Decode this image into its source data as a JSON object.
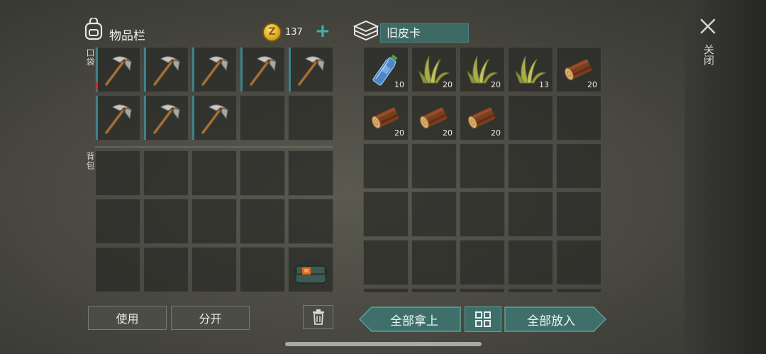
{
  "inventory": {
    "title": "物品栏",
    "coins": "137",
    "pocket_label": "口袋",
    "backpack_label": "背包",
    "pocket_slots": [
      {
        "item": "pickaxe-icon",
        "qty": "",
        "mark": "red"
      },
      {
        "item": "pickaxe-icon",
        "qty": "",
        "mark": "teal"
      },
      {
        "item": "pickaxe-icon",
        "qty": "",
        "mark": "teal"
      },
      {
        "item": "pickaxe-icon",
        "qty": "",
        "mark": "teal"
      },
      {
        "item": "pickaxe-icon",
        "qty": "",
        "mark": "teal"
      },
      {
        "item": "pickaxe-icon",
        "qty": "",
        "mark": "teal"
      },
      {
        "item": "pickaxe-icon",
        "qty": "",
        "mark": "teal"
      },
      {
        "item": "pickaxe-icon",
        "qty": "",
        "mark": "teal"
      },
      {
        "item": "",
        "qty": "",
        "mark": ""
      },
      {
        "item": "",
        "qty": "",
        "mark": ""
      }
    ],
    "backpack_slots": [
      {
        "item": ""
      },
      {
        "item": ""
      },
      {
        "item": ""
      },
      {
        "item": ""
      },
      {
        "item": ""
      },
      {
        "item": ""
      },
      {
        "item": ""
      },
      {
        "item": ""
      },
      {
        "item": ""
      },
      {
        "item": ""
      },
      {
        "item": ""
      },
      {
        "item": ""
      },
      {
        "item": ""
      },
      {
        "item": ""
      },
      {
        "item": "bag-icon"
      }
    ]
  },
  "container": {
    "name": "旧皮卡",
    "slots": [
      {
        "item": "water-bottle-icon",
        "qty": "10"
      },
      {
        "item": "plant-fiber-icon",
        "qty": "20"
      },
      {
        "item": "plant-fiber-icon",
        "qty": "20"
      },
      {
        "item": "plant-fiber-icon",
        "qty": "13"
      },
      {
        "item": "log-icon",
        "qty": "20"
      },
      {
        "item": "log-icon",
        "qty": "20"
      },
      {
        "item": "log-icon",
        "qty": "20"
      },
      {
        "item": "log-icon",
        "qty": "20"
      },
      {
        "item": "",
        "qty": ""
      },
      {
        "item": "",
        "qty": ""
      },
      {
        "item": "",
        "qty": ""
      },
      {
        "item": "",
        "qty": ""
      },
      {
        "item": "",
        "qty": ""
      },
      {
        "item": "",
        "qty": ""
      },
      {
        "item": "",
        "qty": ""
      },
      {
        "item": "",
        "qty": ""
      },
      {
        "item": "",
        "qty": ""
      },
      {
        "item": "",
        "qty": ""
      },
      {
        "item": "",
        "qty": ""
      },
      {
        "item": "",
        "qty": ""
      },
      {
        "item": "",
        "qty": ""
      },
      {
        "item": "",
        "qty": ""
      },
      {
        "item": "",
        "qty": ""
      },
      {
        "item": "",
        "qty": ""
      },
      {
        "item": "",
        "qty": ""
      },
      {
        "item": "",
        "qty": ""
      },
      {
        "item": "",
        "qty": ""
      },
      {
        "item": "",
        "qty": ""
      },
      {
        "item": "",
        "qty": ""
      },
      {
        "item": "",
        "qty": ""
      }
    ]
  },
  "buttons": {
    "use": "使用",
    "split": "分开",
    "take_all": "全部拿上",
    "put_all": "全部放入",
    "close": "关闭"
  },
  "colors": {
    "accent": "#3fb7a6",
    "teal_button": "#3e6f6b",
    "slot_marker": "#3d8388",
    "durability_low": "#b83a2c"
  }
}
